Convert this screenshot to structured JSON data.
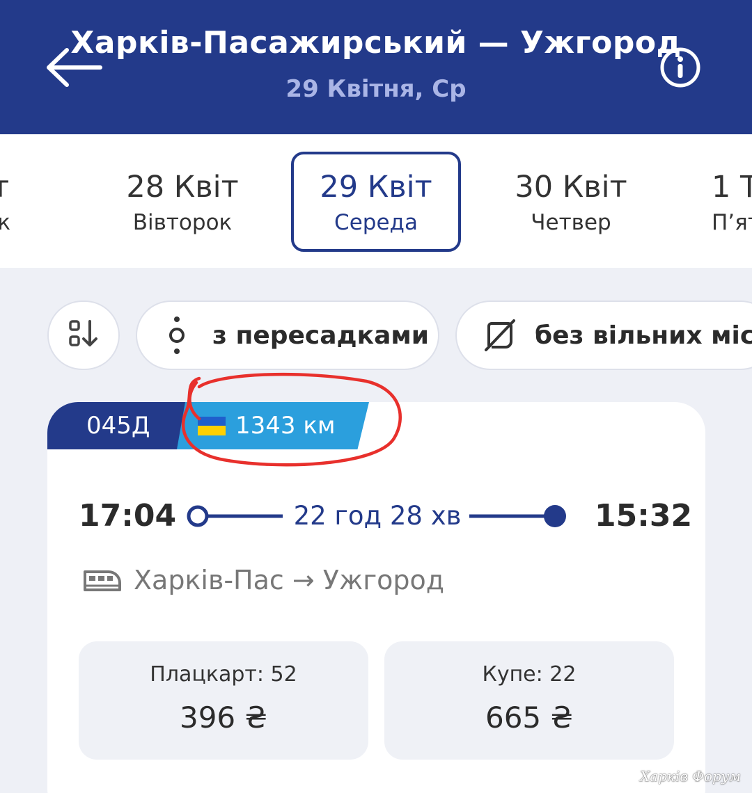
{
  "header": {
    "title": "Харків-Пасажирський — Ужгород",
    "date": "29 Квітня, Ср",
    "colors": {
      "bg": "#233a8a",
      "subtitle": "#aab5e6"
    }
  },
  "date_tabs": [
    {
      "day": "віт",
      "weekday": "ілок"
    },
    {
      "day": "28 Квіт",
      "weekday": "Вівторок"
    },
    {
      "day": "29 Квіт",
      "weekday": "Середа",
      "selected": true
    },
    {
      "day": "30 Квіт",
      "weekday": "Четвер"
    },
    {
      "day": "1 Т",
      "weekday": "П’ят"
    }
  ],
  "filters": {
    "with_transfers": "з пересадками",
    "no_free_seats": "без вільних місц"
  },
  "train": {
    "number": "045Д",
    "distance": "1343 км",
    "departure": "17:04",
    "duration": "22 год 28 хв",
    "arrival": "15:32",
    "route": "Харків-Пас → Ужгород",
    "fares": [
      {
        "class": "Плацкарт: 52",
        "price": "396 ₴"
      },
      {
        "class": "Купе: 22",
        "price": "665 ₴"
      }
    ]
  },
  "watermark": "Харків Форум",
  "icons": [
    "back-arrow-icon",
    "info-icon",
    "sort-icon",
    "transfer-icon",
    "no-seats-icon",
    "train-icon",
    "ukraine-flag-icon"
  ]
}
